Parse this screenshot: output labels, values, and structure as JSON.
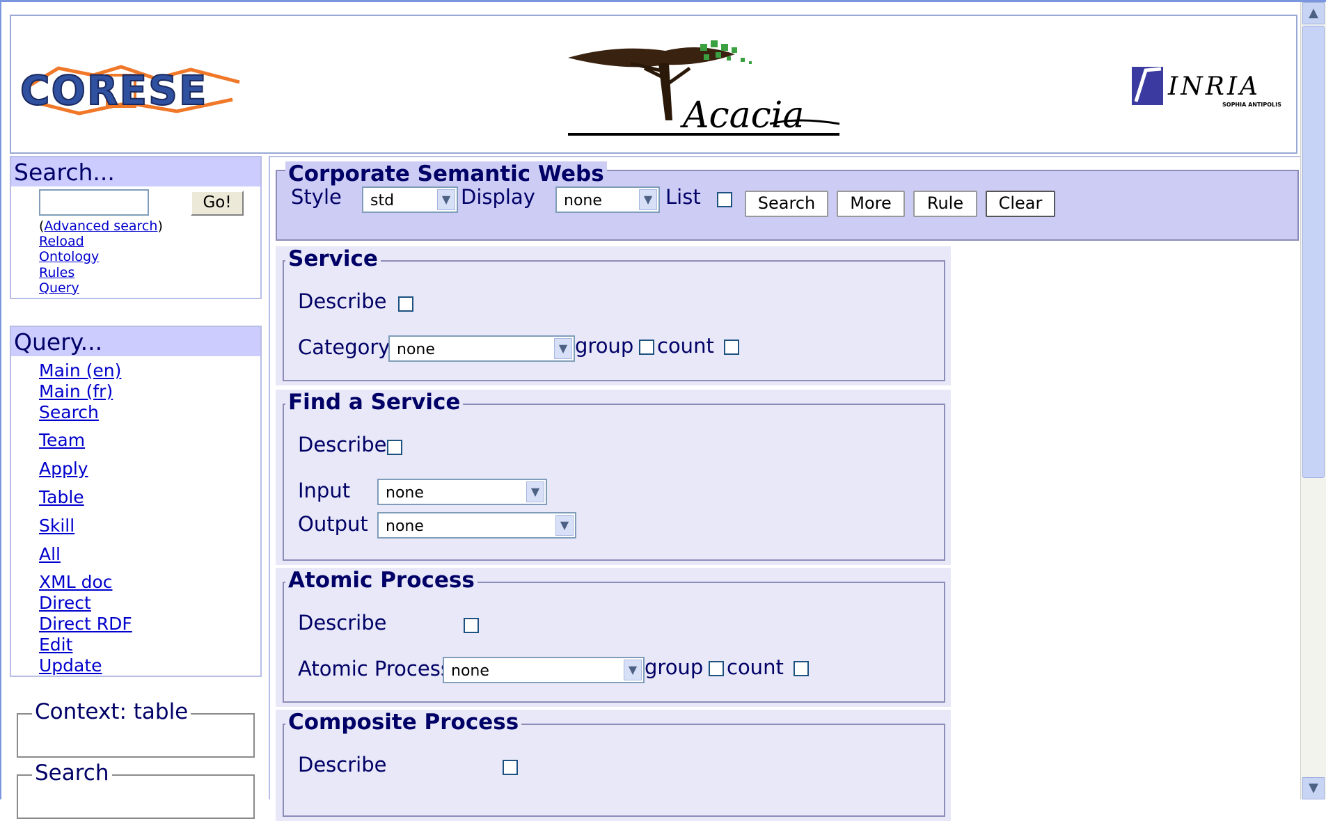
{
  "banner": {
    "left_logo_text": "CORESE",
    "center_logo_text": "Acacia",
    "right_logo_text": "INRIA",
    "right_logo_sub": "SOPHIA ANTIPOLIS"
  },
  "search_box": {
    "title": "Search...",
    "input_value": "",
    "go_label": "Go!",
    "advanced_open": "(",
    "advanced_label": "Advanced search",
    "advanced_close": ")",
    "links": [
      "Reload",
      "Ontology",
      "Rules",
      "Query"
    ]
  },
  "query_box": {
    "title": "Query...",
    "links": [
      "Main (en)",
      "Main (fr)",
      "Search",
      "Team",
      "Apply",
      "Table",
      "Skill",
      "All",
      "XML doc",
      "Direct",
      "Direct RDF",
      "Edit",
      "Update"
    ]
  },
  "context_box": {
    "legend": "Context: table"
  },
  "search_fieldset": {
    "legend": "Search"
  },
  "corporate": {
    "legend": "Corporate Semantic Webs",
    "style_label": "Style",
    "style_value": "std",
    "display_label": "Display",
    "display_value": "none",
    "list_label": "List",
    "buttons": [
      "Search",
      "More",
      "Rule",
      "Clear"
    ]
  },
  "service": {
    "legend": "Service",
    "describe_label": "Describe",
    "category_label": "Category",
    "category_value": "none",
    "group_label": "group",
    "count_label": "count"
  },
  "find_service": {
    "legend": "Find a Service",
    "describe_label": "Describe",
    "input_label": "Input",
    "input_value": "none",
    "output_label": "Output",
    "output_value": "none"
  },
  "atomic": {
    "legend": "Atomic Process",
    "describe_label": "Describe",
    "process_label": "Atomic Process",
    "process_value": "none",
    "group_label": "group",
    "count_label": "count"
  },
  "composite": {
    "legend": "Composite Process",
    "describe_label": "Describe"
  },
  "colors": {
    "heading_blue": "#000066",
    "panel_bg": "#e8e8f8",
    "header_bg": "#ccccff",
    "link": "#0000cc"
  }
}
